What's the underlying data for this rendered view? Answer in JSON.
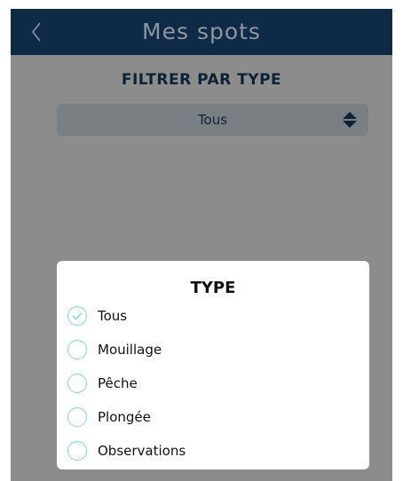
{
  "header": {
    "title": "Mes spots",
    "back_icon": "chevron-left-icon"
  },
  "filter": {
    "label": "FILTRER PAR TYPE",
    "selected_value": "Tous",
    "select_icon": "sort-arrows-icon"
  },
  "dialog": {
    "title": "TYPE",
    "options": [
      {
        "label": "Tous",
        "selected": true
      },
      {
        "label": "Mouillage",
        "selected": false
      },
      {
        "label": "Pêche",
        "selected": false
      },
      {
        "label": "Plongée",
        "selected": false
      },
      {
        "label": "Observations",
        "selected": false
      }
    ]
  },
  "colors": {
    "header_bg": "#0e2a45",
    "overlay": "#8c8c8c",
    "accent": "#7fd3d6",
    "text_dark": "#0e2236"
  }
}
